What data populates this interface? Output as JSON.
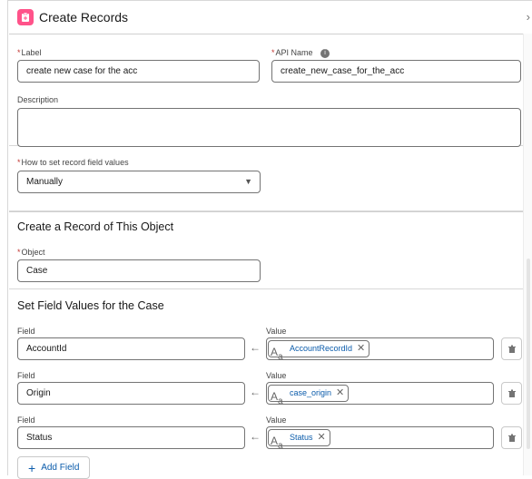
{
  "header": {
    "title": "Create Records",
    "icon": "clipboard-icon",
    "close_icon": "chevron-right-icon"
  },
  "general": {
    "label_label": "Label",
    "label_value": "create new case for the acc",
    "api_label": "API Name",
    "api_value": "create_new_case_for_the_acc",
    "info_icon": "info-icon",
    "description_label": "Description",
    "description_value": ""
  },
  "how_to_set": {
    "label": "How to set record field values",
    "selected": "Manually"
  },
  "object_section": {
    "title": "Create a Record of This Object",
    "object_label": "Object",
    "object_value": "Case"
  },
  "field_values": {
    "title": "Set Field Values for the Case",
    "field_label": "Field",
    "value_label": "Value",
    "rows": [
      {
        "field": "AccountId",
        "value": "AccountRecordId"
      },
      {
        "field": "Origin",
        "value": "case_origin"
      },
      {
        "field": "Status",
        "value": "Status"
      }
    ],
    "add_label": "Add Field"
  },
  "required_marker": "*"
}
